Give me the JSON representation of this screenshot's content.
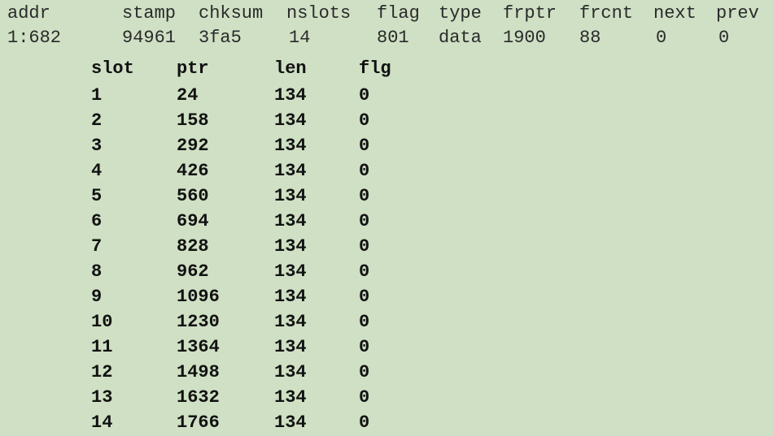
{
  "page_header": {
    "columns": [
      "addr",
      "stamp",
      "chksum",
      "nslots",
      "flag",
      "type",
      "frptr",
      "frcnt",
      "next",
      "prev"
    ],
    "values": [
      "1:682",
      "94961",
      "3fa5",
      "14",
      "801",
      "data",
      "1900",
      "88",
      "0",
      "0"
    ]
  },
  "slot_table": {
    "columns": [
      "slot",
      "ptr",
      "len",
      "flg"
    ],
    "rows": [
      [
        "1",
        "24",
        "134",
        "0"
      ],
      [
        "2",
        "158",
        "134",
        "0"
      ],
      [
        "3",
        "292",
        "134",
        "0"
      ],
      [
        "4",
        "426",
        "134",
        "0"
      ],
      [
        "5",
        "560",
        "134",
        "0"
      ],
      [
        "6",
        "694",
        "134",
        "0"
      ],
      [
        "7",
        "828",
        "134",
        "0"
      ],
      [
        "8",
        "962",
        "134",
        "0"
      ],
      [
        "9",
        "1096",
        "134",
        "0"
      ],
      [
        "10",
        "1230",
        "134",
        "0"
      ],
      [
        "11",
        "1364",
        "134",
        "0"
      ],
      [
        "12",
        "1498",
        "134",
        "0"
      ],
      [
        "13",
        "1632",
        "134",
        "0"
      ],
      [
        "14",
        "1766",
        "134",
        "0"
      ]
    ]
  }
}
